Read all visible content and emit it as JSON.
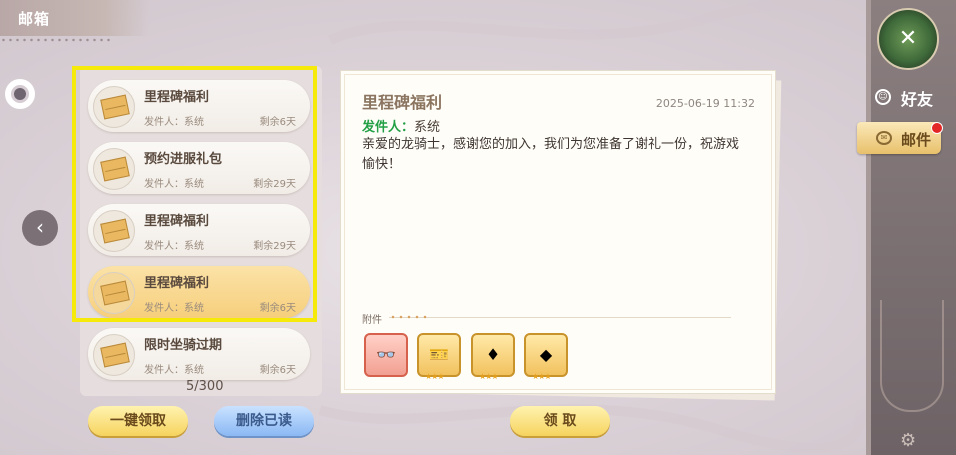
{
  "window": {
    "title": "邮箱"
  },
  "mail_list": {
    "items": [
      {
        "title": "里程碑福利",
        "sender": "发件人：系统",
        "expires": "剩余6天",
        "selected": false
      },
      {
        "title": "预约进服礼包",
        "sender": "发件人：系统",
        "expires": "剩余29天",
        "selected": false
      },
      {
        "title": "里程碑福利",
        "sender": "发件人：系统",
        "expires": "剩余29天",
        "selected": false
      },
      {
        "title": "里程碑福利",
        "sender": "发件人：系统",
        "expires": "剩余6天",
        "selected": true
      },
      {
        "title": "限时坐骑过期",
        "sender": "发件人：系统",
        "expires": "剩余6天",
        "selected": false
      }
    ],
    "count": "5/300",
    "claim_all_label": "一键领取",
    "delete_read_label": "删除已读"
  },
  "letter": {
    "title": "里程碑福利",
    "date": "2025-06-19 11:32",
    "sender_label": "发件人：",
    "sender_value": "系统",
    "body": "亲爱的龙骑士，感谢您的加入，我们为您准备了谢礼一份，祝游戏愉快！",
    "attachments_label": "附件",
    "attachments": [
      {
        "icon": "glasses-icon",
        "frame": "red",
        "glyph": "👓",
        "stars": ""
      },
      {
        "icon": "ticket-icon",
        "frame": "gold",
        "glyph": "🎫",
        "stars": "★★★"
      },
      {
        "icon": "red-gem-icon",
        "frame": "gold",
        "glyph": "♦",
        "stars": "★★★"
      },
      {
        "icon": "blue-gem-icon",
        "frame": "gold",
        "glyph": "◆",
        "stars": "★★★"
      }
    ],
    "claim_label": "领 取"
  },
  "sidebar": {
    "emblem_icon": "crossed-swords-icon",
    "friends_label": "好友",
    "mail_label": "邮件"
  },
  "colors": {
    "highlight": "#f6ea0b",
    "sender_green": "#23a046",
    "badge_red": "#e32626"
  }
}
